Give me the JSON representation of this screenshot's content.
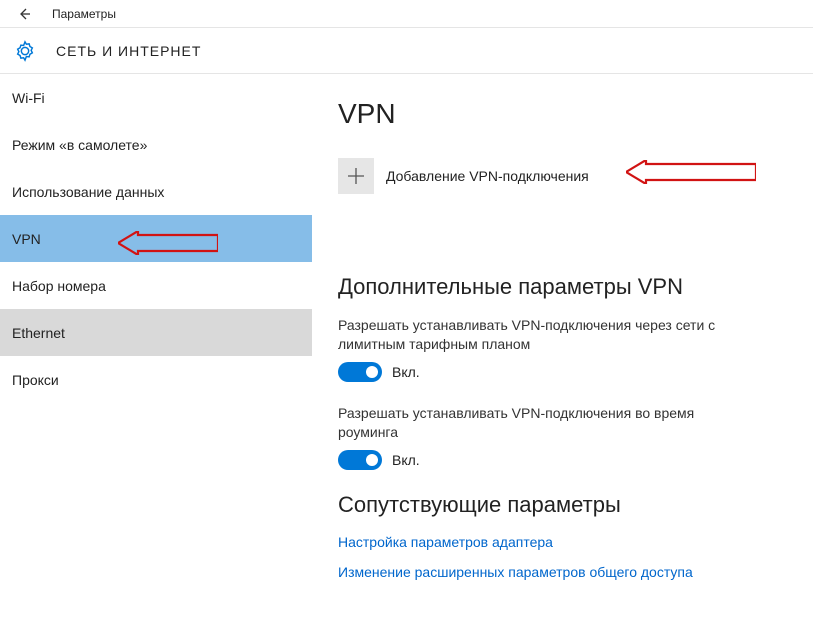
{
  "titlebar": {
    "app_title": "Параметры"
  },
  "header": {
    "title": "СЕТЬ И ИНТЕРНЕТ"
  },
  "sidebar": {
    "items": [
      {
        "label": "Wi-Fi",
        "state": ""
      },
      {
        "label": "Режим «в самолете»",
        "state": ""
      },
      {
        "label": "Использование данных",
        "state": ""
      },
      {
        "label": "VPN",
        "state": "selected"
      },
      {
        "label": "Набор номера",
        "state": ""
      },
      {
        "label": "Ethernet",
        "state": "hover"
      },
      {
        "label": "Прокси",
        "state": ""
      }
    ]
  },
  "content": {
    "page_title": "VPN",
    "add_vpn_label": "Добавление VPN-подключения",
    "advanced_title": "Дополнительные параметры VPN",
    "setting1_desc": "Разрешать устанавливать VPN-подключения через сети с лимитным тарифным планом",
    "setting1_state": "Вкл.",
    "setting2_desc": "Разрешать устанавливать VPN-подключения во время роуминга",
    "setting2_state": "Вкл.",
    "related_title": "Сопутствующие параметры",
    "link1": "Настройка параметров адаптера",
    "link2": "Изменение расширенных параметров общего доступа"
  }
}
